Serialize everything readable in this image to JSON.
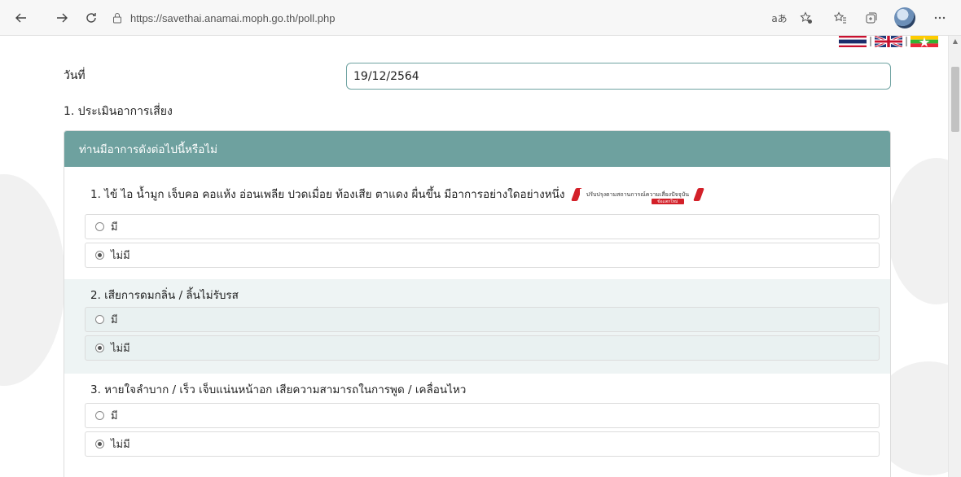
{
  "browser": {
    "url": "https://savethai.anamai.moph.go.th/poll.php",
    "reader_label": "aあ"
  },
  "page": {
    "date_label": "วันที่",
    "date_value": "19/12/2564",
    "section_title": "1. ประเมินอาการเสี่ยง",
    "card_header": "ท่านมีอาการดังต่อไปนี้หรือไม่",
    "questions": [
      {
        "text": "1. ไข้ ไอ น้ำมูก เจ็บคอ คอแห้ง อ่อนเพลีย ปวดเมื่อย ท้องเสีย ตาแดง ผื่นขึ้น มีอาการอย่างใดอย่างหนึ่ง",
        "badge_text": "ปรับปรุงตามสถานการณ์ความเสี่ยงปัจจุบัน",
        "badge_sub": "ข้อเเตกใหม่",
        "options": [
          {
            "label": "มี",
            "selected": false
          },
          {
            "label": "ไม่มี",
            "selected": true
          }
        ]
      },
      {
        "text": "2. เสียการดมกลิ่น / ลิ้นไม่รับรส",
        "options": [
          {
            "label": "มี",
            "selected": false
          },
          {
            "label": "ไม่มี",
            "selected": true
          }
        ]
      },
      {
        "text": "3. หายใจลำบาก / เร็ว เจ็บแน่นหน้าอก เสียความสามารถในการพูด / เคลื่อนไหว",
        "options": [
          {
            "label": "มี",
            "selected": false
          },
          {
            "label": "ไม่มี",
            "selected": true
          }
        ]
      }
    ]
  },
  "icons": [
    "back-icon",
    "forward-icon",
    "refresh-icon",
    "lock-icon",
    "read-aloud-icon",
    "add-favorite-icon",
    "favorites-icon",
    "collections-icon",
    "profile-avatar",
    "more-icon",
    "thai-flag-icon",
    "uk-flag-icon",
    "myanmar-flag-icon"
  ],
  "colors": {
    "header_bg": "#6ea19f",
    "input_border": "#6fa3a2",
    "shaded_row": "#eef4f4",
    "badge_red": "#d32029"
  }
}
